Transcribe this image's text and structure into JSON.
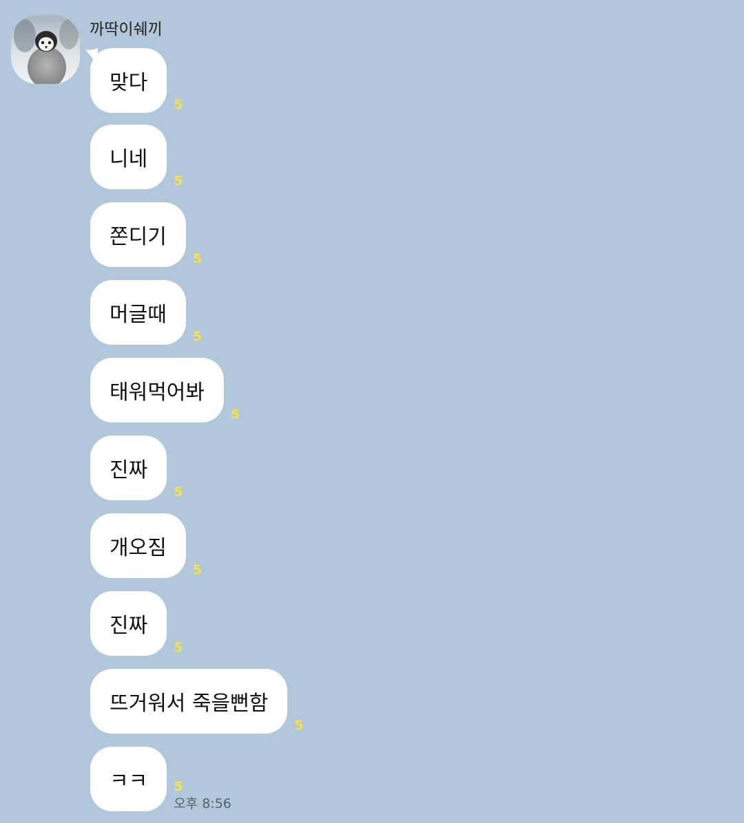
{
  "sender": {
    "name": "까딱이쉐끼",
    "avatar_icon": "penguin-chick-avatar"
  },
  "messages": [
    {
      "text": "맞다",
      "unread": "5"
    },
    {
      "text": "니네",
      "unread": "5"
    },
    {
      "text": "쫀디기",
      "unread": "5"
    },
    {
      "text": "머글때",
      "unread": "5"
    },
    {
      "text": "태워먹어봐",
      "unread": "5"
    },
    {
      "text": "진짜",
      "unread": "5"
    },
    {
      "text": "개오짐",
      "unread": "5"
    },
    {
      "text": "진짜",
      "unread": "5"
    },
    {
      "text": "뜨거워서 죽을뻔함",
      "unread": "5"
    },
    {
      "text": "ㅋㅋ",
      "unread": "5",
      "time": "오후 8:56"
    }
  ],
  "colors": {
    "background": "#b2c7da",
    "bubble": "#ffffff",
    "unread": "#f7e445"
  }
}
